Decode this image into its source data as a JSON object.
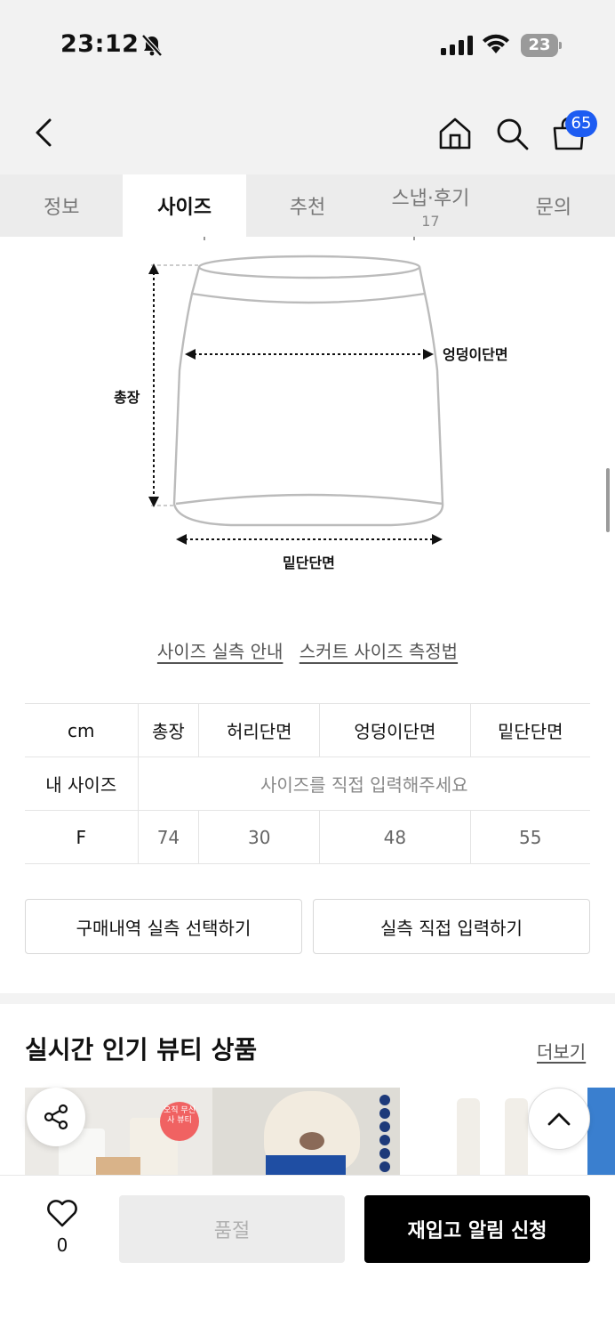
{
  "status_bar": {
    "time": "23:12",
    "battery": "23"
  },
  "header": {
    "cart_count": "65"
  },
  "tabs": [
    {
      "label": "정보",
      "count": ""
    },
    {
      "label": "사이즈",
      "count": ""
    },
    {
      "label": "추천",
      "count": ""
    },
    {
      "label": "스냅·후기",
      "count": "17"
    },
    {
      "label": "문의",
      "count": ""
    }
  ],
  "diagram": {
    "hip_label": "엉덩이단면",
    "length_label": "총장",
    "hem_label": "밑단단면"
  },
  "links": {
    "guide": "사이즈 실측 안내",
    "measure": "스커트 사이즈 측정법"
  },
  "size_table": {
    "headers": [
      "cm",
      "총장",
      "허리단면",
      "엉덩이단면",
      "밑단단면"
    ],
    "my_size_label": "내 사이즈",
    "my_size_hint": "사이즈를 직접 입력해주세요",
    "rows": [
      {
        "size": "F",
        "values": [
          "74",
          "30",
          "48",
          "55"
        ]
      }
    ]
  },
  "buttons": {
    "purchase_history": "구매내역 실측 선택하기",
    "direct_input": "실측 직접 입력하기"
  },
  "section": {
    "title": "실시간 인기 뷰티 상품",
    "more": "더보기"
  },
  "products": {
    "badge_text": "오직 무신사 뷰티"
  },
  "bottom_bar": {
    "like_count": "0",
    "soldout_label": "품절",
    "restock_label": "재입고 알림 신청"
  }
}
